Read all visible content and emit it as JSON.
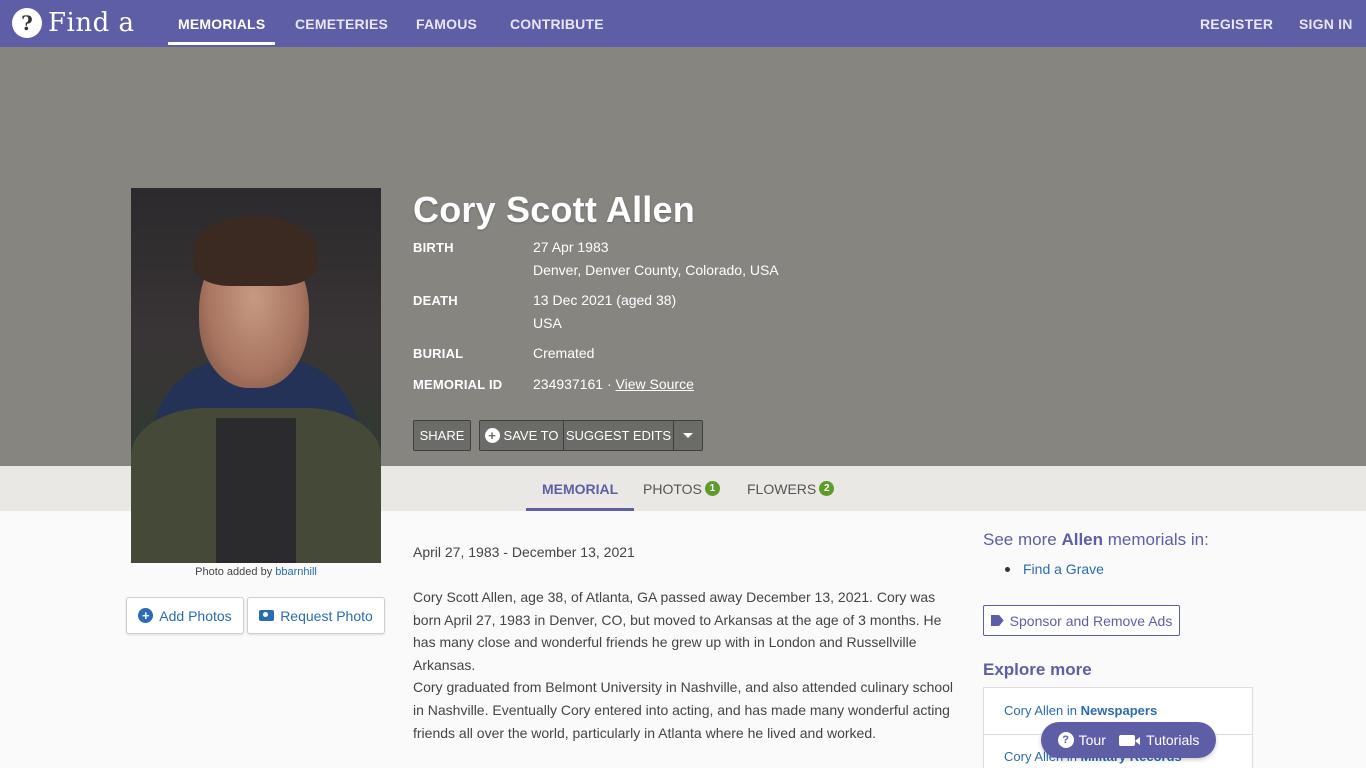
{
  "header": {
    "logo_text": "Find a Gra",
    "nav": [
      {
        "label": "MEMORIALS"
      },
      {
        "label": "CEMETERIES"
      },
      {
        "label": "FAMOUS"
      },
      {
        "label": "CONTRIBUTE"
      }
    ],
    "register_label": "REGISTER",
    "signin_label": "SIGN IN",
    "colors": {
      "nav_bg": "#5e5ea6",
      "hero_bg": "#868580"
    }
  },
  "memorial": {
    "name": "Cory Scott Allen",
    "birth_label": "BIRTH",
    "birth_date": "27 Apr 1983",
    "birth_place": "Denver, Denver County, Colorado, USA",
    "death_label": "DEATH",
    "death_date": "13 Dec 2021 (aged 38)",
    "death_place": "USA",
    "burial_label": "BURIAL",
    "burial_value": "Cremated",
    "memorial_id_label": "MEMORIAL ID",
    "memorial_id": "234937161",
    "memorial_id_sep": " · ",
    "view_source": "View Source"
  },
  "actions": {
    "share": "SHARE",
    "save_to": "SAVE TO",
    "suggest_edits": "SUGGEST EDITS"
  },
  "photo": {
    "credit_prefix": "Photo added by",
    "credit_user": "bbarnhill",
    "add_photos": "Add Photos",
    "request_photo": "Request Photo"
  },
  "tabs": [
    {
      "label": "MEMORIAL"
    },
    {
      "label": "PHOTOS",
      "count": "1"
    },
    {
      "label": "FLOWERS",
      "count": "2"
    }
  ],
  "content": {
    "date_range": "April 27, 1983 - December 13, 2021",
    "bio_p1": "Cory Scott Allen, age 38, of Atlanta, GA passed away December 13, 2021. Cory was born April 27, 1983 in Denver, CO, but moved to Arkansas at the age of 3 months. He has many close and wonderful friends he grew up with in London and Russellville Arkansas.",
    "bio_p2": "Cory graduated from Belmont University in Nashville, and also attended culinary school in Nashville. Eventually Cory entered into acting, and has made many wonderful acting friends all over the world, particularly in Atlanta where he lived and worked."
  },
  "sidebar": {
    "see_more_prefix": "See more ",
    "see_more_name": "Allen",
    "see_more_suffix": " memorials in:",
    "see_more_link": "Find a Grave",
    "sponsor": "Sponsor and Remove Ads",
    "explore_title": "Explore more",
    "explore_items": [
      {
        "prefix": "Cory Allen in ",
        "bold": "Newspapers"
      },
      {
        "prefix": "Cory Allen in ",
        "bold": "Military Records"
      }
    ]
  },
  "helper": {
    "tour": "Tour",
    "tutorials": "Tutorials"
  }
}
